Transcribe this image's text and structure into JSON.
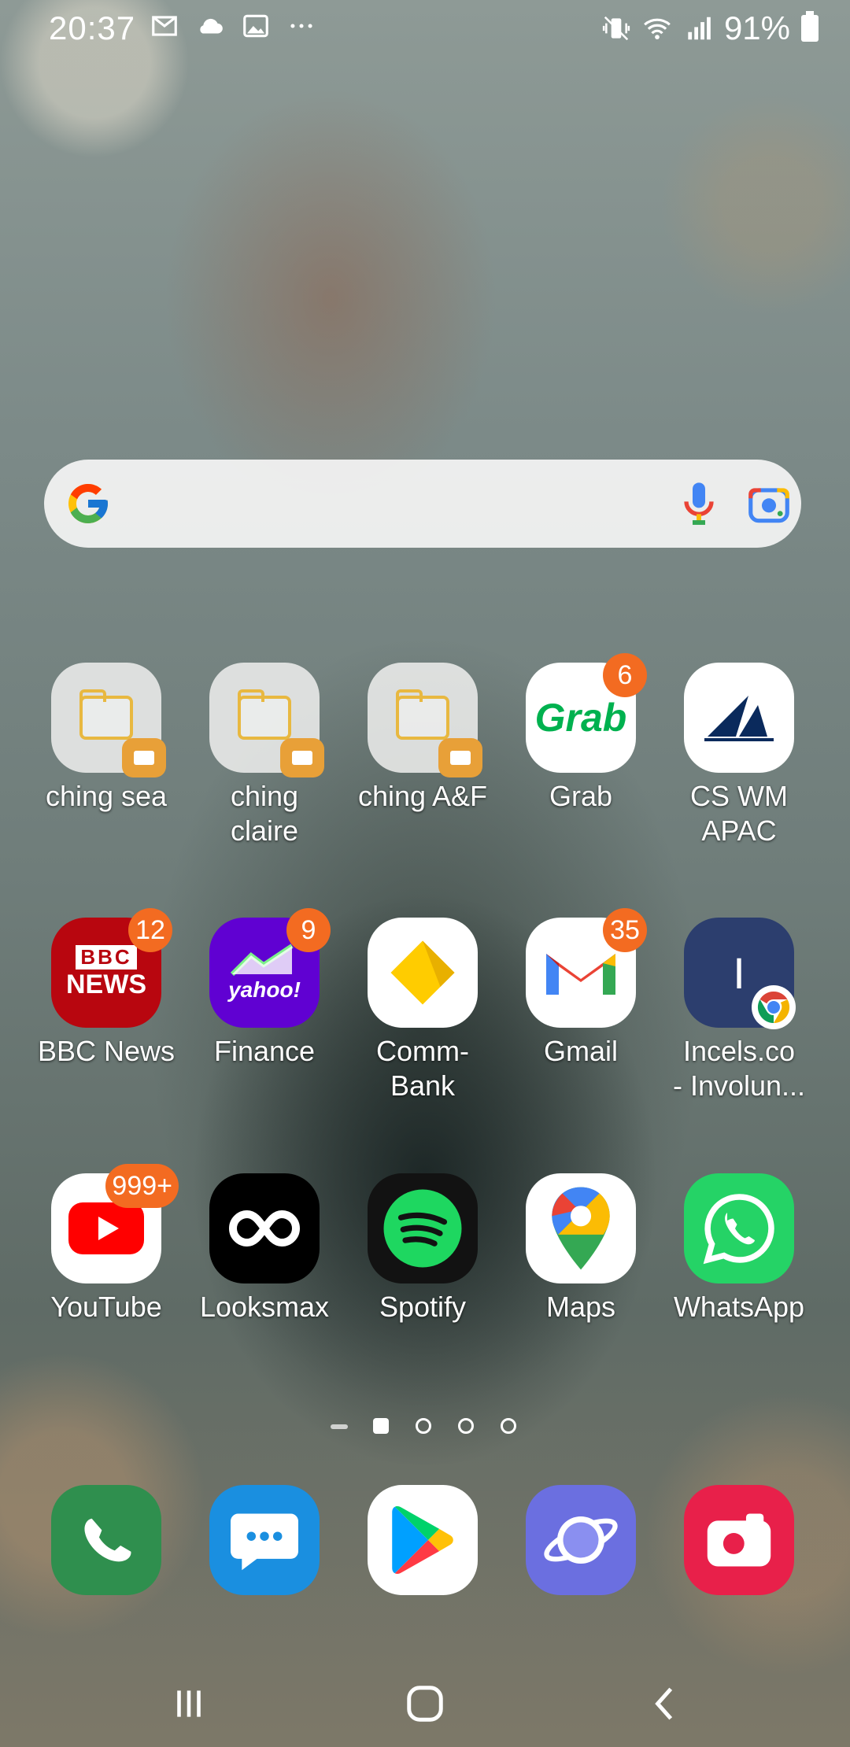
{
  "status_bar": {
    "time": "20:37",
    "battery": "91%",
    "notification_icons": [
      "gmail-icon",
      "cloud-icon",
      "gallery-icon",
      "more-icon"
    ],
    "system_icons": [
      "vibrate-icon",
      "wifi-icon",
      "signal-icon",
      "battery-icon"
    ]
  },
  "search_widget": {
    "icons": [
      "google-logo-icon",
      "microphone-icon",
      "lens-camera-icon"
    ]
  },
  "apps": [
    {
      "label": "ching sea",
      "icon": "folder-icon",
      "badge": ""
    },
    {
      "label": "ching\nclaire",
      "icon": "folder-icon",
      "badge": ""
    },
    {
      "label": "ching A&F",
      "icon": "folder-icon",
      "badge": ""
    },
    {
      "label": "Grab",
      "icon": "grab-icon",
      "badge": "6"
    },
    {
      "label": "CS WM\nAPAC",
      "icon": "cs-sail-icon",
      "badge": ""
    },
    {
      "label": "BBC News",
      "icon": "bbc-news-icon",
      "badge": "12"
    },
    {
      "label": "Finance",
      "icon": "yahoo-finance-icon",
      "badge": "9"
    },
    {
      "label": "Comm-\nBank",
      "icon": "commbank-icon",
      "badge": ""
    },
    {
      "label": "Gmail",
      "icon": "gmail-icon",
      "badge": "35"
    },
    {
      "label": "Incels.co\n- Involun...",
      "icon": "incels-chrome-icon",
      "badge": ""
    },
    {
      "label": "YouTube",
      "icon": "youtube-icon",
      "badge": "999+"
    },
    {
      "label": "Looksmax",
      "icon": "looksmax-icon",
      "badge": ""
    },
    {
      "label": "Spotify",
      "icon": "spotify-icon",
      "badge": ""
    },
    {
      "label": "Maps",
      "icon": "maps-icon",
      "badge": ""
    },
    {
      "label": "WhatsApp",
      "icon": "whatsapp-icon",
      "badge": ""
    }
  ],
  "icon_text": {
    "grab": "Grab",
    "bbc_top": "BBC",
    "bbc_bottom": "NEWS",
    "yahoo": "yahoo!",
    "incels_letter": "I"
  },
  "page_indicator": {
    "pages": 4,
    "current": 1
  },
  "dock": [
    "phone-icon",
    "messages-icon",
    "play-store-icon",
    "samsung-internet-icon",
    "screen-recorder-icon"
  ],
  "nav_bar": [
    "recents-icon",
    "home-icon",
    "back-icon"
  ],
  "colors": {
    "badge": "#f36b21",
    "bbc": "#b8060f",
    "yahoo": "#6001d2",
    "commbank": "#ffcc00",
    "spotify": "#1ed760",
    "whatsapp": "#25d366",
    "phone": "#2f8f4e",
    "messages": "#1a8fe0",
    "internet": "#6b6fe0",
    "recorder": "#e8204a"
  }
}
